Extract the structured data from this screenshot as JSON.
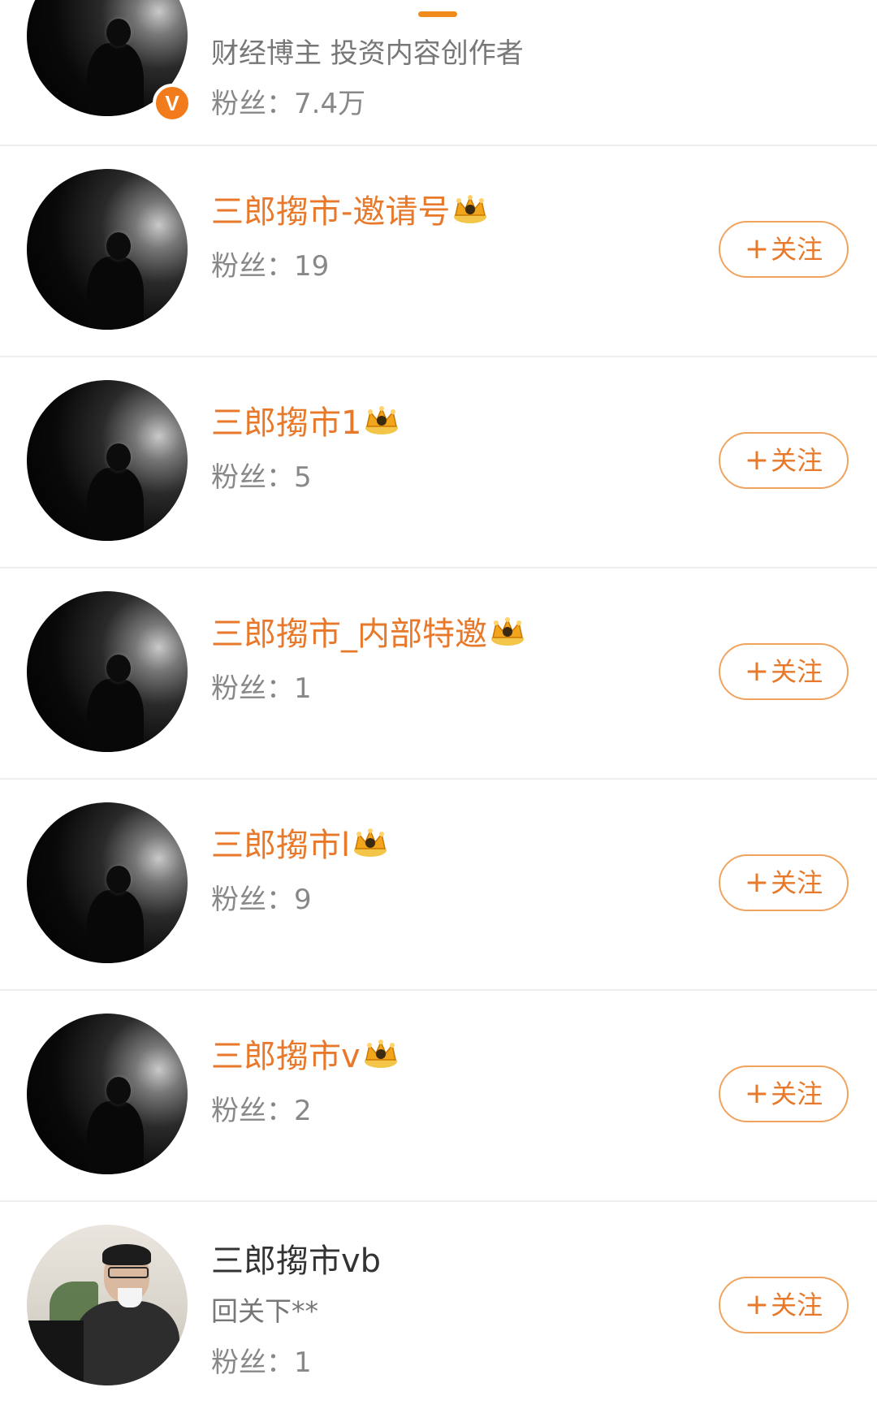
{
  "header": {
    "bio": "财经博主  投资内容创作者",
    "fans": "粉丝：7.4万",
    "badge": "V"
  },
  "accounts": [
    {
      "name": "三郎搊市-邀请号",
      "fans": "粉丝：19",
      "follow_label": "关注"
    },
    {
      "name": "三郎搊市1",
      "fans": "粉丝：5",
      "follow_label": "关注"
    },
    {
      "name": "三郎搊市_内部特邀",
      "fans": "粉丝：1",
      "follow_label": "关注"
    },
    {
      "name": "三郎搊市l",
      "fans": "粉丝：9",
      "follow_label": "关注"
    },
    {
      "name": "三郎搊市v",
      "fans": "粉丝：2",
      "follow_label": "关注"
    },
    {
      "name": "三郎搊市vb",
      "desc": "回关下**",
      "fans": "粉丝：1",
      "follow_label": "关注"
    }
  ],
  "colors": {
    "accent": "#e8792b",
    "badge": "#f27b1b",
    "divider": "#eeeeee"
  },
  "icons": {
    "plus": "+",
    "crown": "crown-icon"
  }
}
